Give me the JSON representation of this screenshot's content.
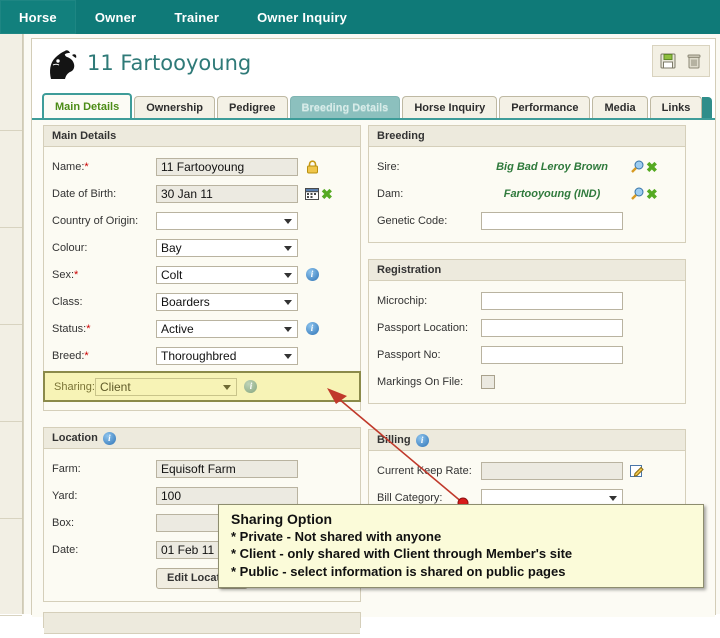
{
  "topnav": {
    "items": [
      {
        "label": "Horse",
        "active": true
      },
      {
        "label": "Owner",
        "active": false
      },
      {
        "label": "Trainer",
        "active": false
      },
      {
        "label": "Owner Inquiry",
        "active": false
      }
    ]
  },
  "header": {
    "title": "11 Fartooyoung",
    "logo_icon": "horse-head-icon",
    "tools": [
      {
        "name": "save-icon",
        "label": "Save"
      },
      {
        "name": "delete-icon",
        "label": "Delete"
      }
    ]
  },
  "tabs": [
    {
      "label": "Main Details",
      "state": "active"
    },
    {
      "label": "Ownership",
      "state": "normal"
    },
    {
      "label": "Pedigree",
      "state": "normal"
    },
    {
      "label": "Breeding Details",
      "state": "disabled"
    },
    {
      "label": "Horse Inquiry",
      "state": "normal"
    },
    {
      "label": "Performance",
      "state": "normal"
    },
    {
      "label": "Media",
      "state": "normal"
    },
    {
      "label": "Links",
      "state": "normal"
    }
  ],
  "main_details": {
    "title": "Main Details",
    "name": {
      "label": "Name:",
      "required": true,
      "value": "11 Fartooyoung",
      "lock_icon": "padlock-icon"
    },
    "dob": {
      "label": "Date of Birth:",
      "required": false,
      "value": "30 Jan 11",
      "calendar_icon": "calendar-icon",
      "clear_icon": "green-x-icon"
    },
    "country": {
      "label": "Country of Origin:",
      "required": false,
      "value": ""
    },
    "colour": {
      "label": "Colour:",
      "required": false,
      "value": "Bay"
    },
    "sex": {
      "label": "Sex:",
      "required": true,
      "value": "Colt",
      "info_icon": "info-icon"
    },
    "class": {
      "label": "Class:",
      "required": false,
      "value": "Boarders"
    },
    "status": {
      "label": "Status:",
      "required": true,
      "value": "Active",
      "info_icon": "info-icon"
    },
    "breed": {
      "label": "Breed:",
      "required": true,
      "value": "Thoroughbred"
    },
    "sharing": {
      "label": "Sharing:",
      "required": false,
      "value": "Client",
      "info_icon": "info-icon",
      "highlighted": true
    }
  },
  "breeding": {
    "title": "Breeding",
    "sire": {
      "label": "Sire:",
      "value": "Big Bad Leroy Brown",
      "search_icon": "magnifier-icon",
      "clear_icon": "green-x-icon"
    },
    "dam": {
      "label": "Dam:",
      "value": "Fartooyoung (IND)",
      "search_icon": "magnifier-icon",
      "clear_icon": "green-x-icon"
    },
    "genetic_code": {
      "label": "Genetic Code:",
      "value": ""
    }
  },
  "registration": {
    "title": "Registration",
    "microchip": {
      "label": "Microchip:",
      "value": ""
    },
    "passport_location": {
      "label": "Passport Location:",
      "value": ""
    },
    "passport_no": {
      "label": "Passport No:",
      "value": ""
    },
    "markings": {
      "label": "Markings On File:",
      "checked": false
    }
  },
  "location": {
    "title": "Location",
    "info_icon": "info-icon",
    "farm": {
      "label": "Farm:",
      "value": "Equisoft Farm"
    },
    "yard": {
      "label": "Yard:",
      "value": "100"
    },
    "box": {
      "label": "Box:",
      "value": ""
    },
    "date": {
      "label": "Date:",
      "value": "01 Feb 11"
    },
    "edit_button": "Edit Location"
  },
  "billing": {
    "title": "Billing",
    "info_icon": "info-icon",
    "current_keep_rate": {
      "label": "Current Keep Rate:",
      "value": "",
      "edit_icon": "edit-note-icon"
    },
    "bill_category": {
      "label": "Bill Category:",
      "value": ""
    }
  },
  "tooltip": {
    "title": "Sharing Option",
    "lines": [
      "* Private - Not shared with anyone",
      "* Client - only shared with Client through Member's site",
      "* Public - select information is shared on public pages"
    ]
  },
  "colors": {
    "nav_teal": "#0f7a78",
    "nav_active_teal": "#12807d",
    "title_teal": "#2f7a78",
    "active_tab_text": "#4c8c17",
    "highlight_yellow": "#f7f3b6",
    "annotation_red": "#c0392b",
    "tooltip_bg": "#fbfbd9",
    "link_green": "#2f7a3c"
  }
}
